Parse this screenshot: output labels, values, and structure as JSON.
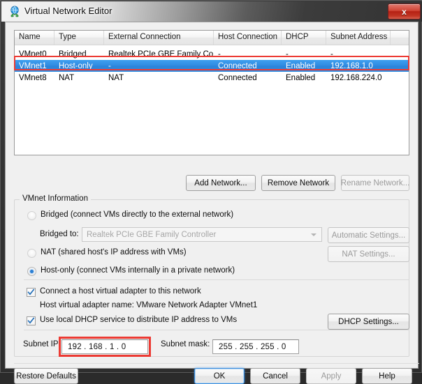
{
  "window": {
    "title": "Virtual Network Editor",
    "icon": "network-globe-icon",
    "close_label": "x",
    "accent_selection": "#2b83da",
    "highlight_box_color": "#ec3a33"
  },
  "network_list": {
    "columns": [
      "Name",
      "Type",
      "External Connection",
      "Host Connection",
      "DHCP",
      "Subnet Address",
      ""
    ],
    "rows": [
      {
        "name": "VMnet0",
        "type": "Bridged",
        "external_connection": "Realtek PCIe GBE Family Co...",
        "host_connection": "-",
        "dhcp": "-",
        "subnet_address": "-",
        "selected": false
      },
      {
        "name": "VMnet1",
        "type": "Host-only",
        "external_connection": "-",
        "host_connection": "Connected",
        "dhcp": "Enabled",
        "subnet_address": "192.168.1.0",
        "selected": true
      },
      {
        "name": "VMnet8",
        "type": "NAT",
        "external_connection": "NAT",
        "host_connection": "Connected",
        "dhcp": "Enabled",
        "subnet_address": "192.168.224.0",
        "selected": false
      }
    ]
  },
  "list_actions": {
    "add_network": "Add Network...",
    "remove_network": "Remove Network",
    "rename_network": "Rename Network..."
  },
  "vmnet_information": {
    "group_title": "VMnet Information",
    "bridged_label": "Bridged (connect VMs directly to the external network)",
    "bridged_to_label": "Bridged to:",
    "bridged_to_value": "Realtek PCIe GBE Family Controller",
    "automatic_settings": "Automatic Settings...",
    "nat_label": "NAT (shared host's IP address with VMs)",
    "nat_settings": "NAT Settings...",
    "host_only_label": "Host-only (connect VMs internally in a private network)",
    "selected_mode": "host-only",
    "connect_adapter_label": "Connect a host virtual adapter to this network",
    "connect_adapter_checked": true,
    "adapter_name_label": "Host virtual adapter name: VMware Network Adapter VMnet1",
    "local_dhcp_label": "Use local DHCP service to distribute IP address to VMs",
    "local_dhcp_checked": true,
    "dhcp_settings": "DHCP Settings...",
    "subnet_ip_label": "Subnet IP:",
    "subnet_ip_value": "192 . 168 .  1  .  0",
    "subnet_mask_label": "Subnet mask:",
    "subnet_mask_value": "255 . 255 . 255 .  0"
  },
  "dialog_buttons": {
    "restore_defaults": "Restore Defaults",
    "ok": "OK",
    "cancel": "Cancel",
    "apply": "Apply",
    "help": "Help"
  }
}
